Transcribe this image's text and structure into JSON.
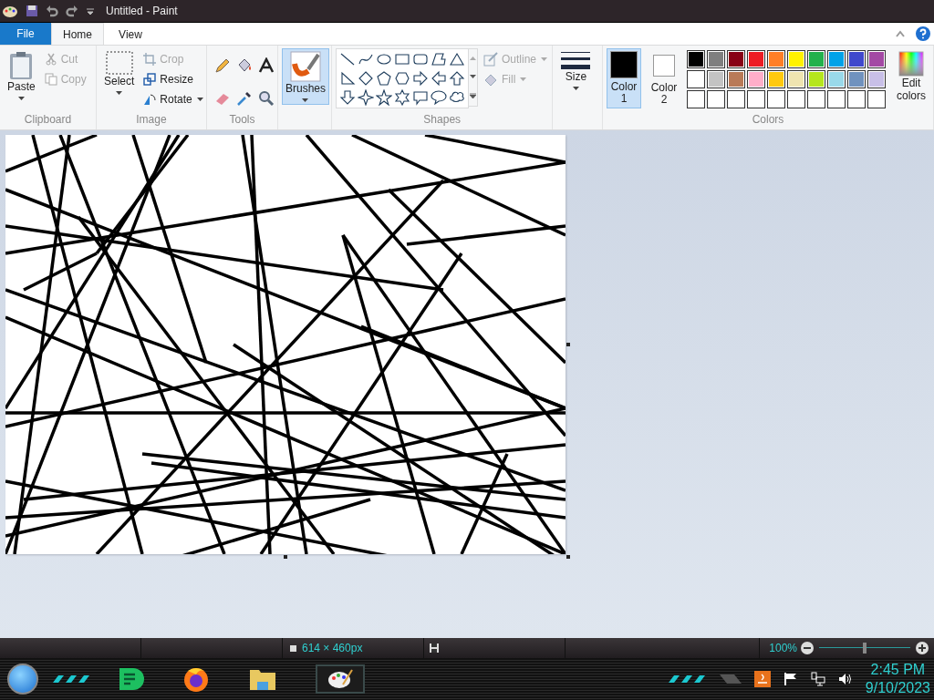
{
  "window": {
    "title": "Untitled - Paint"
  },
  "tabs": [
    {
      "label": "File",
      "kind": "file",
      "selected": false
    },
    {
      "label": "Home",
      "kind": "tab",
      "selected": true
    },
    {
      "label": "View",
      "kind": "tab",
      "selected": false
    }
  ],
  "clipboard": {
    "label": "Clipboard",
    "paste": "Paste",
    "cut": {
      "label": "Cut",
      "disabled": true
    },
    "copy": {
      "label": "Copy",
      "disabled": true
    }
  },
  "image": {
    "label": "Image",
    "select": "Select",
    "crop": {
      "label": "Crop",
      "disabled": true
    },
    "resize": {
      "label": "Resize",
      "disabled": false
    },
    "rotate": {
      "label": "Rotate",
      "disabled": false
    }
  },
  "tools": {
    "label": "Tools"
  },
  "brushes": {
    "label": "Brushes",
    "selected": true
  },
  "shapes": {
    "label": "Shapes",
    "outline": {
      "label": "Outline",
      "disabled": true
    },
    "fill": {
      "label": "Fill",
      "disabled": true
    }
  },
  "size": {
    "label": "Size"
  },
  "colors": {
    "label": "Colors",
    "color1": {
      "label": "Color",
      "number": "1",
      "color": "#000000",
      "selected": true
    },
    "color2": {
      "label": "Color",
      "number": "2",
      "color": "#ffffff",
      "selected": false
    },
    "palette": [
      {
        "color": "#000000"
      },
      {
        "color": "#7f7f7f"
      },
      {
        "color": "#880015"
      },
      {
        "color": "#ed1c24"
      },
      {
        "color": "#ff7f27"
      },
      {
        "color": "#fff200"
      },
      {
        "color": "#22b14c"
      },
      {
        "color": "#00a2e8"
      },
      {
        "color": "#3f48cc"
      },
      {
        "color": "#a349a4"
      },
      {
        "color": "#ffffff"
      },
      {
        "color": "#c3c3c3"
      },
      {
        "color": "#b97a57"
      },
      {
        "color": "#ffaec9"
      },
      {
        "color": "#ffc90e"
      },
      {
        "color": "#efe4b0"
      },
      {
        "color": "#b5e61d"
      },
      {
        "color": "#99d9ea"
      },
      {
        "color": "#7092be"
      },
      {
        "color": "#c8bfe7"
      }
    ],
    "edit_line1": "Edit",
    "edit_line2": "colors"
  },
  "status_bar": {
    "canvas_size": "614 × 460px",
    "zoom": "100%",
    "zoom_level": {
      "level": 0.5
    }
  },
  "taskbar": {
    "time": "2:45 PM",
    "date": "9/10/2023"
  }
}
